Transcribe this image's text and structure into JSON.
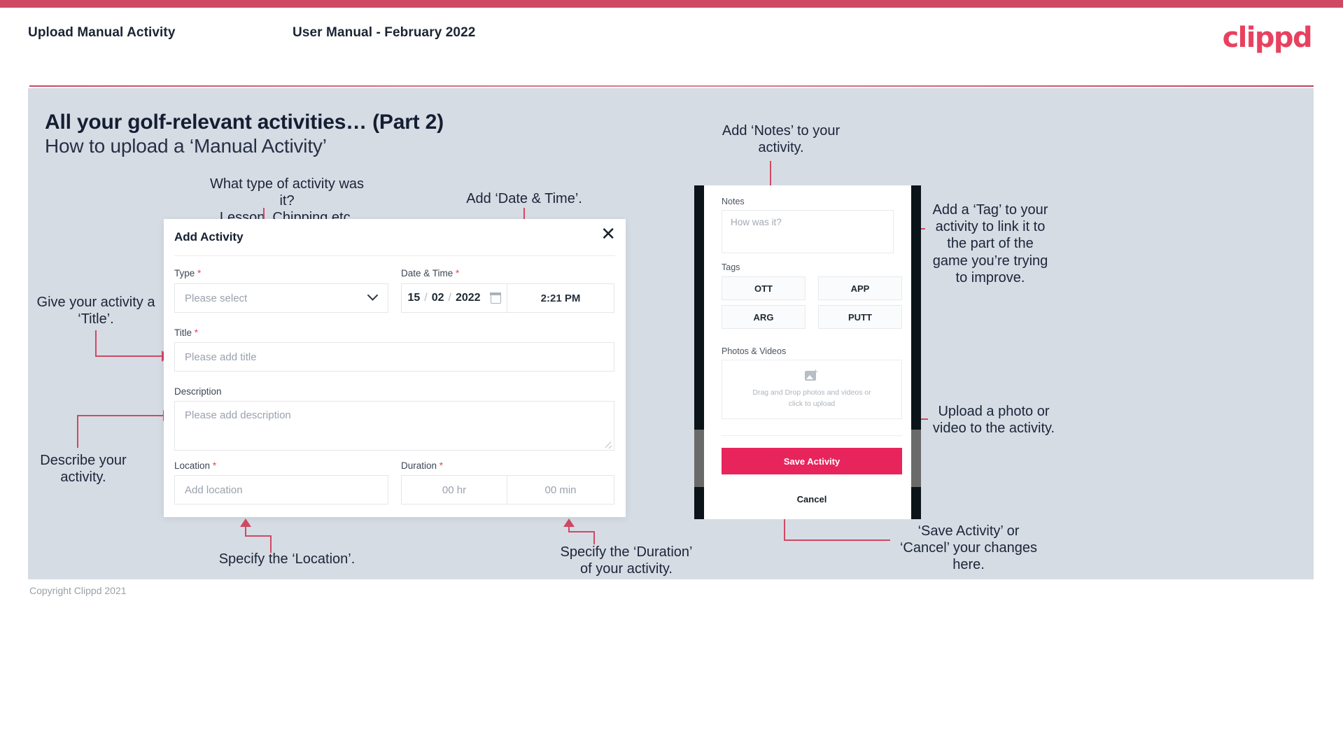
{
  "header": {
    "left_title": "Upload Manual Activity",
    "center_title": "User Manual - February 2022",
    "logo": "clippd"
  },
  "slide": {
    "title": "All your golf-relevant activities… (Part 2)",
    "subtitle": "How to upload a ‘Manual Activity’"
  },
  "annotations": {
    "type": "What type of activity was it?\nLesson, Chipping etc.",
    "date_time": "Add ‘Date & Time’.",
    "title": "Give your activity a\n‘Title’.",
    "description": "Describe your\nactivity.",
    "location": "Specify the ‘Location’.",
    "duration": "Specify the ‘Duration’\nof your activity.",
    "notes": "Add ‘Notes’ to your\nactivity.",
    "tags": "Add a ‘Tag’ to your\nactivity to link it to\nthe part of the\ngame you’re trying\nto improve.",
    "upload": "Upload a photo or\nvideo to the activity.",
    "save_cancel": "‘Save Activity’ or\n‘Cancel’ your changes\nhere."
  },
  "dialog": {
    "title": "Add Activity",
    "close_icon": "close-icon",
    "fields": {
      "type": {
        "label": "Type",
        "required": "*",
        "placeholder": "Please select"
      },
      "datetime": {
        "label": "Date & Time",
        "required": "*",
        "day": "15",
        "month": "02",
        "year": "2022",
        "sep": "/",
        "time": "2:21 PM"
      },
      "title": {
        "label": "Title",
        "required": "*",
        "placeholder": "Please add title"
      },
      "description": {
        "label": "Description",
        "required": "",
        "placeholder": "Please add description"
      },
      "location": {
        "label": "Location",
        "required": "*",
        "placeholder": "Add location"
      },
      "duration": {
        "label": "Duration",
        "required": "*",
        "hours": "00 hr",
        "minutes": "00 min"
      }
    }
  },
  "phone": {
    "notes": {
      "label": "Notes",
      "placeholder": "How was it?"
    },
    "tags": {
      "label": "Tags",
      "items": [
        "OTT",
        "APP",
        "ARG",
        "PUTT"
      ]
    },
    "media": {
      "label": "Photos & Videos",
      "dropzone_line1": "Drag and Drop photos and videos or",
      "dropzone_line2": "click to upload",
      "icon": "image-add-icon"
    },
    "save_label": "Save Activity",
    "cancel_label": "Cancel"
  },
  "footer": {
    "copyright": "Copyright Clippd 2021"
  },
  "colors": {
    "accent": "#cf4963",
    "brand_pink": "#e8415f",
    "save_button": "#e8245c",
    "slide_bg": "#d6dce4",
    "text_dark": "#1b2539"
  }
}
